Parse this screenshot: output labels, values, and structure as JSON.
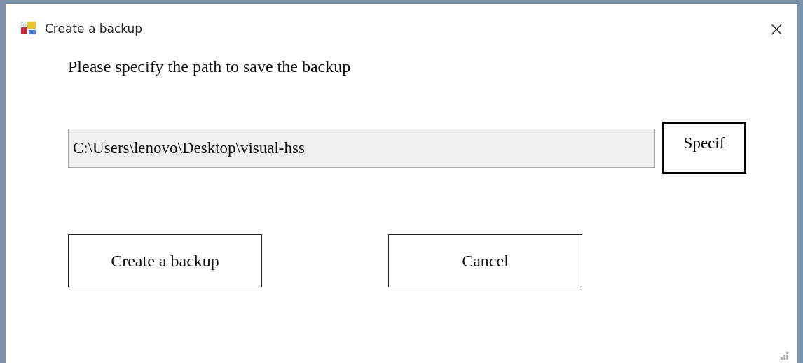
{
  "window": {
    "title": "Create a backup",
    "close": "×"
  },
  "prompt": "Please specify the path to save the backup",
  "path_field": {
    "value": "C:\\Users\\lenovo\\Desktop\\visual-hss",
    "disabled": true
  },
  "browse_button": {
    "label": "Specif",
    "focused": true
  },
  "buttons": [
    {
      "label": "Create a backup"
    },
    {
      "label": "Cancel"
    }
  ]
}
